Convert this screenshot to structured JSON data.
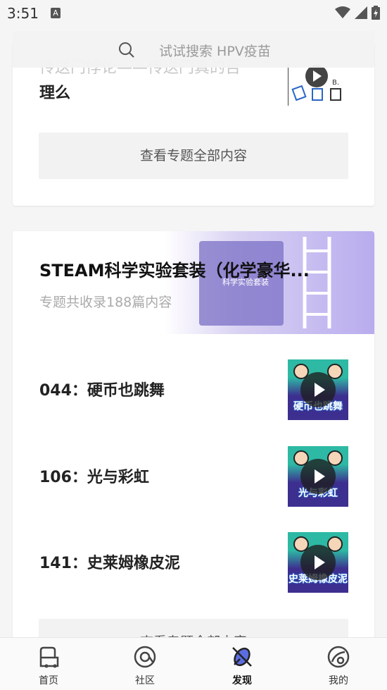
{
  "status_bar": {
    "time": "3:51",
    "notification_icon": "A"
  },
  "search": {
    "placeholder": "试试搜索 HPV疫苗",
    "icon": "search-icon"
  },
  "topic_card_1": {
    "title_line1": "传送门悖论——传送门真的否",
    "title_line2": "理么",
    "view_all": "查看专题全部内容"
  },
  "topic_card_2": {
    "title": "STEAM科学实验套装（化学豪华...",
    "subtitle": "专题共收录188篇内容",
    "banner_text": "科学实验套装",
    "items": [
      {
        "title": "044：硬币也跳舞",
        "thumb_caption": "硬币也跳舞"
      },
      {
        "title": "106：光与彩虹",
        "thumb_caption": "光与彩虹"
      },
      {
        "title": "141：史莱姆橡皮泥",
        "thumb_caption": "史莱姆橡皮泥"
      }
    ],
    "view_all": "查看专题全部内容"
  },
  "bottom_nav": [
    {
      "label": "首页",
      "icon": "home-icon"
    },
    {
      "label": "社区",
      "icon": "community-icon"
    },
    {
      "label": "发现",
      "icon": "discover-icon",
      "active": true
    },
    {
      "label": "我的",
      "icon": "profile-icon"
    }
  ],
  "colors": {
    "background": "#f5f5f5",
    "card": "#ffffff",
    "button_bg": "#f2f2f2",
    "thumb_teal": "#2db9a4",
    "thumb_purple": "#3d2f8f"
  }
}
